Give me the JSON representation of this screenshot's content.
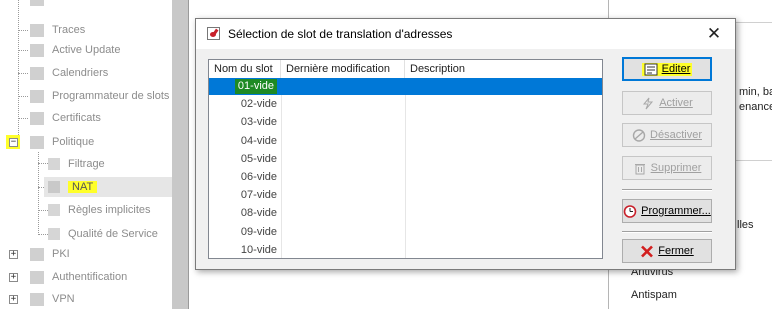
{
  "tree": {
    "items": [
      {
        "label": "Traces"
      },
      {
        "label": "Active Update"
      },
      {
        "label": "Calendriers"
      },
      {
        "label": "Programmateur de slots"
      },
      {
        "label": "Certificats"
      },
      {
        "label": "Politique"
      },
      {
        "label": "Filtrage"
      },
      {
        "label": "NAT"
      },
      {
        "label": "Règles implicites"
      },
      {
        "label": "Qualité de Service"
      },
      {
        "label": "PKI"
      },
      {
        "label": "Authentification"
      },
      {
        "label": "VPN"
      }
    ],
    "expander_minus": "−",
    "expander_plus": "+"
  },
  "right_panel": {
    "text_1": "min, bas",
    "text_2": "enance,",
    "text_3": "lles",
    "text_4": "Antivirus",
    "text_5": "Antispam"
  },
  "dialog": {
    "title": "Sélection de slot de translation d'adresses",
    "close_glyph": "✕",
    "columns": [
      "Nom du slot",
      "Dernière modification",
      "Description"
    ],
    "rows": [
      {
        "name": "01-vide",
        "modified": "",
        "description": ""
      },
      {
        "name": "02-vide",
        "modified": "",
        "description": ""
      },
      {
        "name": "03-vide",
        "modified": "",
        "description": ""
      },
      {
        "name": "04-vide",
        "modified": "",
        "description": ""
      },
      {
        "name": "05-vide",
        "modified": "",
        "description": ""
      },
      {
        "name": "06-vide",
        "modified": "",
        "description": ""
      },
      {
        "name": "07-vide",
        "modified": "",
        "description": ""
      },
      {
        "name": "08-vide",
        "modified": "",
        "description": ""
      },
      {
        "name": "09-vide",
        "modified": "",
        "description": ""
      },
      {
        "name": "10-vide",
        "modified": "",
        "description": ""
      }
    ],
    "selected_row": 0,
    "buttons": {
      "edit": "Editer",
      "activate": "Activer",
      "deactivate": "Désactiver",
      "delete": "Supprimer",
      "schedule": "Programmer...",
      "close": "Fermer"
    }
  },
  "colors": {
    "selection": "#0078d7",
    "highlight": "#ffff2a",
    "name_highlight": "#1e8a24"
  }
}
